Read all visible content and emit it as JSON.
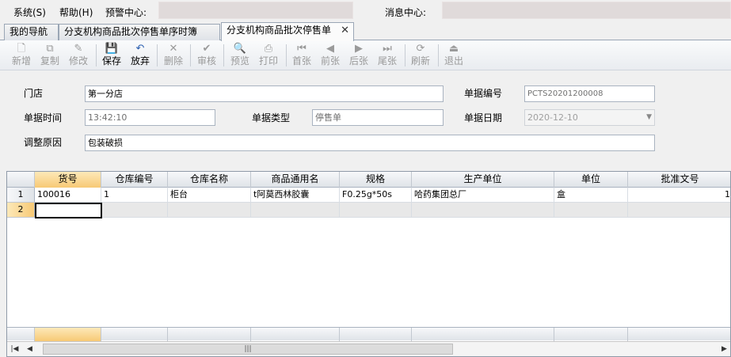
{
  "menu": {
    "system": "系统(S)",
    "help": "帮助(H)",
    "alert_label": "预警中心:",
    "message_label": "消息中心:"
  },
  "tabs": [
    {
      "label": "我的导航"
    },
    {
      "label": "分支机构商品批次停售单序时簿"
    },
    {
      "label": "分支机构商品批次停售单",
      "close": "✕"
    }
  ],
  "toolbar": [
    {
      "label": "新增",
      "icon": "new-doc-icon",
      "glyph": "🗋",
      "enabled": false
    },
    {
      "label": "复制",
      "icon": "copy-icon",
      "glyph": "⧉",
      "enabled": false
    },
    {
      "label": "修改",
      "icon": "edit-icon",
      "glyph": "✎",
      "enabled": false
    },
    {
      "label": "保存",
      "icon": "save-icon",
      "glyph": "💾",
      "enabled": true
    },
    {
      "label": "放弃",
      "icon": "undo-icon",
      "glyph": "↶",
      "enabled": true
    },
    {
      "label": "删除",
      "icon": "delete-icon",
      "glyph": "✕",
      "enabled": false
    },
    {
      "label": "审核",
      "icon": "audit-icon",
      "glyph": "✔",
      "enabled": false
    },
    {
      "label": "预览",
      "icon": "preview-icon",
      "glyph": "🔍",
      "enabled": false
    },
    {
      "label": "打印",
      "icon": "print-icon",
      "glyph": "⎙",
      "enabled": false
    },
    {
      "label": "首张",
      "icon": "first-record-icon",
      "glyph": "⏮",
      "enabled": false
    },
    {
      "label": "前张",
      "icon": "previous-record-icon",
      "glyph": "◀",
      "enabled": false
    },
    {
      "label": "后张",
      "icon": "next-record-icon",
      "glyph": "▶",
      "enabled": false
    },
    {
      "label": "尾张",
      "icon": "last-record-icon",
      "glyph": "⏭",
      "enabled": false
    },
    {
      "label": "刷新",
      "icon": "refresh-icon",
      "glyph": "⟳",
      "enabled": false
    },
    {
      "label": "退出",
      "icon": "exit-icon",
      "glyph": "⏏",
      "enabled": false
    }
  ],
  "form": {
    "store_label": "门店",
    "store_value": "第一分店",
    "docno_label": "单据编号",
    "docno_value": "PCTS20201200008",
    "time_label": "单据时间",
    "time_value": "13:42:10",
    "type_label": "单据类型",
    "type_value": "停售单",
    "date_label": "单据日期",
    "date_value": "2020-12-10",
    "reason_label": "调整原因",
    "reason_value": "包装破损"
  },
  "grid": {
    "columns": [
      "货号",
      "仓库编号",
      "仓库名称",
      "商品通用名",
      "规格",
      "生产单位",
      "单位",
      "批准文号"
    ],
    "rows": [
      {
        "num": "1",
        "cells": [
          "100016",
          "1",
          "柜台",
          "t阿莫西林胶囊",
          "F0.25g*50s",
          "哈药集团总厂",
          "盒",
          ""
        ],
        "overflow": "1"
      },
      {
        "num": "2",
        "cells": [
          "",
          "",
          "",
          "",
          "",
          "",
          "",
          ""
        ],
        "overflow": ""
      }
    ],
    "scroll_grip": "|||",
    "scroll_left": "◀",
    "scroll_right": "▶",
    "scroll_home": "|◀"
  }
}
